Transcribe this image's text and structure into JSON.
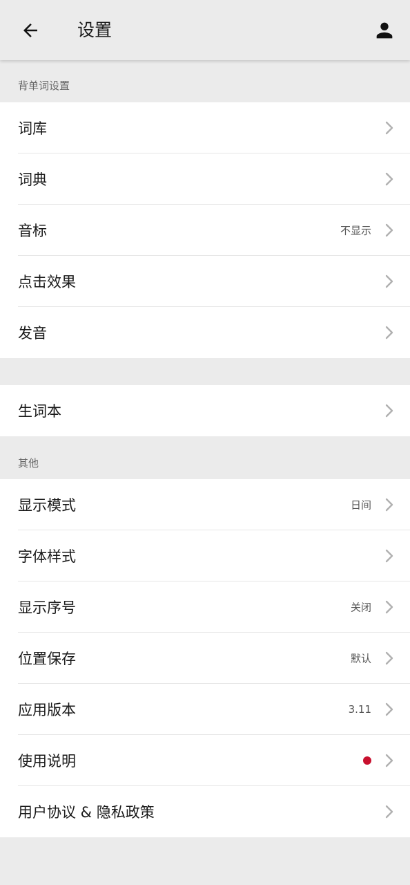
{
  "header": {
    "title": "设置"
  },
  "sections": {
    "vocab_settings_title": "背单词设置",
    "other_title": "其他"
  },
  "vocab_items": [
    {
      "label": "词库",
      "value": ""
    },
    {
      "label": "词典",
      "value": ""
    },
    {
      "label": "音标",
      "value": "不显示"
    },
    {
      "label": "点击效果",
      "value": ""
    },
    {
      "label": "发音",
      "value": ""
    }
  ],
  "notebook_items": [
    {
      "label": "生词本",
      "value": ""
    }
  ],
  "other_items": [
    {
      "label": "显示模式",
      "value": "日间"
    },
    {
      "label": "字体样式",
      "value": ""
    },
    {
      "label": "显示序号",
      "value": "关闭"
    },
    {
      "label": "位置保存",
      "value": "默认"
    },
    {
      "label": "应用版本",
      "value": "3.11"
    },
    {
      "label": "使用说明",
      "value": ""
    },
    {
      "label": "用户协议 & 隐私政策",
      "value": ""
    }
  ],
  "icons": {
    "back": "arrow-left-icon",
    "account": "person-icon",
    "chevron": "chevron-right-icon"
  },
  "colors": {
    "background": "#ebebeb",
    "card": "#ffffff",
    "text": "#1a1a1a",
    "muted": "#666666",
    "chevron": "#b0b0b0",
    "notification_dot": "#c8102e"
  }
}
